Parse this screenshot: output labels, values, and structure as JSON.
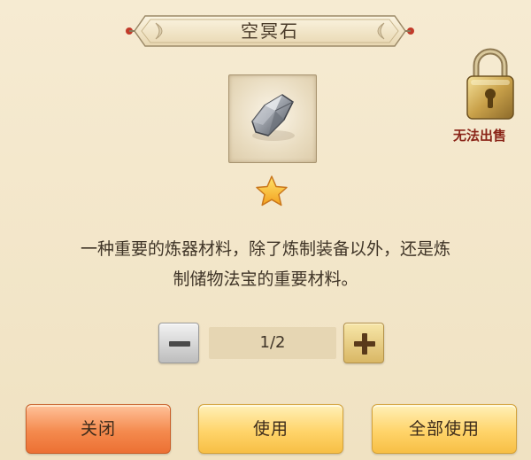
{
  "item": {
    "name": "空冥石",
    "icon": "grey-stone-icon",
    "rarity_stars": 1
  },
  "lock": {
    "icon": "padlock-icon",
    "label": "无法出售"
  },
  "description": {
    "line1": "一种重要的炼器材料，除了炼制装备以外，还是炼",
    "line2": "制储物法宝的重要材料。"
  },
  "quantity": {
    "value": "1/2",
    "minus_icon": "minus-icon",
    "plus_icon": "plus-icon"
  },
  "buttons": {
    "close": "关闭",
    "use": "使用",
    "use_all": "全部使用"
  },
  "colors": {
    "background": "#f3e6c8",
    "lock_label": "#8a2418",
    "close_button": "#f48a4e",
    "use_button": "#ffd46a"
  }
}
